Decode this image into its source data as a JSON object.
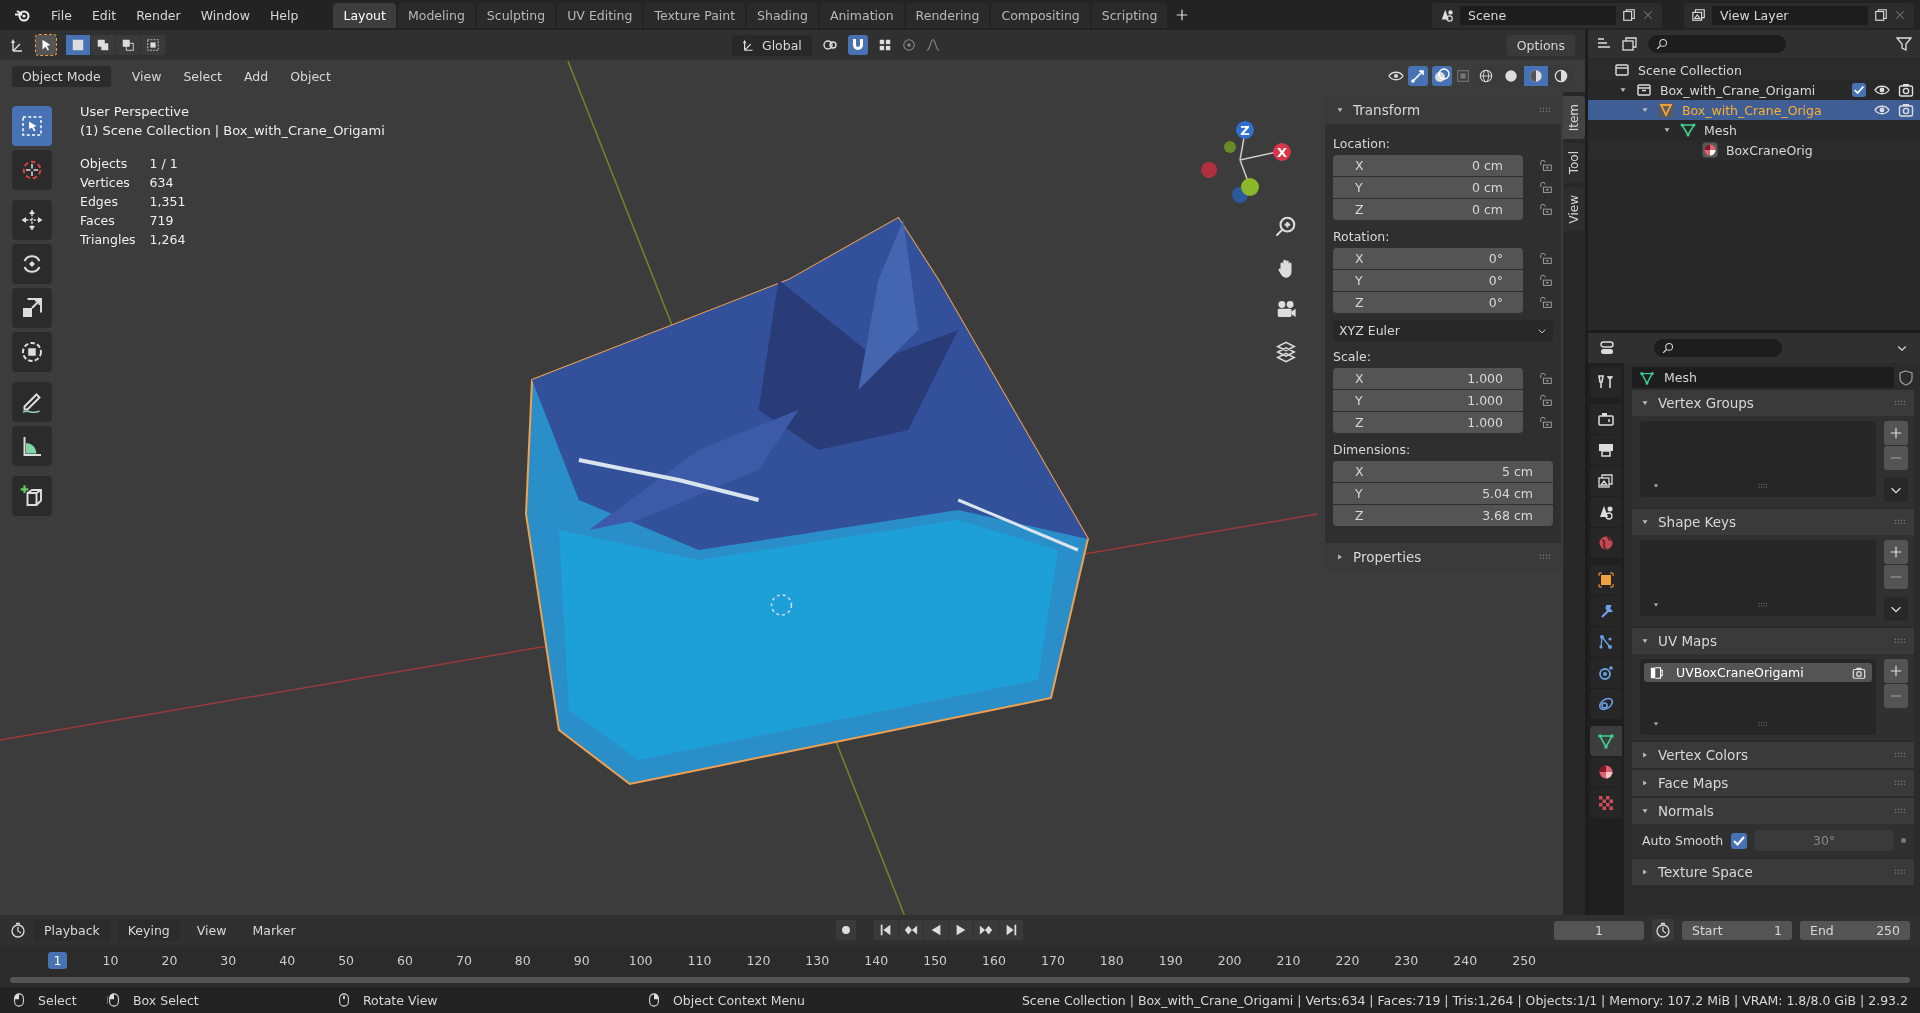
{
  "top_bar": {
    "menus": [
      "File",
      "Edit",
      "Render",
      "Window",
      "Help"
    ],
    "workspaces": [
      {
        "label": "Layout",
        "selected": true
      },
      {
        "label": "Modeling",
        "selected": false
      },
      {
        "label": "Sculpting",
        "selected": false
      },
      {
        "label": "UV Editing",
        "selected": false
      },
      {
        "label": "Texture Paint",
        "selected": false
      },
      {
        "label": "Shading",
        "selected": false
      },
      {
        "label": "Animation",
        "selected": false
      },
      {
        "label": "Rendering",
        "selected": false
      },
      {
        "label": "Compositing",
        "selected": false
      },
      {
        "label": "Scripting",
        "selected": false
      }
    ],
    "scene": "Scene",
    "view_layer": "View Layer"
  },
  "tool_settings": {
    "orientation": "Global",
    "options": "Options"
  },
  "viewport_header": {
    "mode": "Object Mode",
    "menus": [
      "View",
      "Select",
      "Add",
      "Object"
    ]
  },
  "toolbar": [
    {
      "kind": "select",
      "selected": true
    },
    {
      "kind": "cursor",
      "selected": false
    },
    {
      "kind": "move",
      "selected": false
    },
    {
      "kind": "rotate",
      "selected": false
    },
    {
      "kind": "scale",
      "selected": false
    },
    {
      "kind": "transform",
      "selected": false
    },
    {
      "kind": "annotate",
      "selected": false
    },
    {
      "kind": "measure",
      "selected": false
    },
    {
      "kind": "add_cube",
      "selected": false
    }
  ],
  "overlay": {
    "perspective": "User Perspective",
    "collection": "(1) Scene Collection | Box_with_Crane_Origami",
    "stats": [
      {
        "label": "Objects",
        "value": "1 / 1"
      },
      {
        "label": "Vertices",
        "value": "634"
      },
      {
        "label": "Edges",
        "value": "1,351"
      },
      {
        "label": "Faces",
        "value": "719"
      },
      {
        "label": "Triangles",
        "value": "1,264"
      }
    ]
  },
  "gizmo": [
    {
      "label": "Z",
      "color": "#2f6fd0"
    },
    {
      "label": "X",
      "color": "#d8344a"
    }
  ],
  "sidebar": {
    "tabs": [
      {
        "label": "Item",
        "selected": true
      },
      {
        "label": "Tool",
        "selected": false
      },
      {
        "label": "View",
        "selected": false
      }
    ],
    "transform": {
      "title": "Transform",
      "expanded": true,
      "groups": [
        {
          "label": "Location:",
          "locks": true,
          "fields": [
            {
              "axis": "X",
              "value": "0 cm"
            },
            {
              "axis": "Y",
              "value": "0 cm"
            },
            {
              "axis": "Z",
              "value": "0 cm"
            }
          ]
        },
        {
          "label": "Rotation:",
          "locks": true,
          "fields": [
            {
              "axis": "X",
              "value": "0°"
            },
            {
              "axis": "Y",
              "value": "0°"
            },
            {
              "axis": "Z",
              "value": "0°"
            }
          ],
          "mode": "XYZ Euler"
        },
        {
          "label": "Scale:",
          "locks": true,
          "fields": [
            {
              "axis": "X",
              "value": "1.000"
            },
            {
              "axis": "Y",
              "value": "1.000"
            },
            {
              "axis": "Z",
              "value": "1.000"
            }
          ]
        },
        {
          "label": "Dimensions:",
          "locks": false,
          "fields": [
            {
              "axis": "X",
              "value": "5 cm"
            },
            {
              "axis": "Y",
              "value": "5.04 cm"
            },
            {
              "axis": "Z",
              "value": "3.68 cm"
            }
          ]
        }
      ]
    },
    "properties": {
      "title": "Properties",
      "expanded": false
    }
  },
  "outliner": {
    "items": [
      {
        "label": "Scene Collection",
        "kind": "scene",
        "selected": false,
        "children": [
          {
            "label": "Box_with_Crane_Origami",
            "kind": "collection",
            "selected": false,
            "expanded": true,
            "checked": true,
            "children": [
              {
                "label": "Box_with_Crane_Origa",
                "kind": "object",
                "selected": true,
                "expanded": true,
                "children": [
                  {
                    "label": "Mesh",
                    "kind": "mesh",
                    "selected": false,
                    "expanded": true,
                    "children": [
                      {
                        "label": "BoxCraneOrig",
                        "kind": "material",
                        "selected": false
                      }
                    ]
                  }
                ]
              }
            ]
          }
        ]
      }
    ]
  },
  "properties_editor": {
    "tabs": [
      {
        "kind": "tool",
        "selected": false
      },
      {
        "kind": "render",
        "selected": false
      },
      {
        "kind": "output",
        "selected": false
      },
      {
        "kind": "view_layer",
        "selected": false
      },
      {
        "kind": "scene",
        "selected": false
      },
      {
        "kind": "world",
        "selected": false
      },
      {
        "kind": "object",
        "selected": false
      },
      {
        "kind": "modifiers",
        "selected": false
      },
      {
        "kind": "particles",
        "selected": false
      },
      {
        "kind": "physics",
        "selected": false
      },
      {
        "kind": "constraints",
        "selected": false
      },
      {
        "kind": "data",
        "selected": true
      },
      {
        "kind": "material",
        "selected": false
      },
      {
        "kind": "texture",
        "selected": false
      }
    ],
    "datablock": "Mesh",
    "panels": [
      {
        "title": "Vertex Groups",
        "expanded": true,
        "kind": "list",
        "menu": true
      },
      {
        "title": "Shape Keys",
        "expanded": true,
        "kind": "list",
        "menu": true
      },
      {
        "title": "UV Maps",
        "expanded": true,
        "kind": "list",
        "menu": false,
        "items": [
          {
            "label": "UVBoxCraneOrigami",
            "selected": true
          }
        ]
      },
      {
        "title": "Vertex Colors",
        "expanded": false
      },
      {
        "title": "Face Maps",
        "expanded": false
      },
      {
        "title": "Normals",
        "expanded": true,
        "kind": "normals",
        "auto_smooth": {
          "label": "Auto Smooth",
          "checked": true,
          "angle": "30°"
        }
      },
      {
        "title": "Texture Space",
        "expanded": false
      }
    ]
  },
  "timeline": {
    "menus": [
      "Playback",
      "Keying",
      "View",
      "Marker"
    ],
    "current_frame": "1",
    "start_label": "Start",
    "start": "1",
    "end_label": "End",
    "end": "250",
    "ruler": [
      {
        "label": "1",
        "selected": true
      },
      {
        "label": "10",
        "selected": false
      },
      {
        "label": "20",
        "selected": false
      },
      {
        "label": "30",
        "selected": false
      },
      {
        "label": "40",
        "selected": false
      },
      {
        "label": "50",
        "selected": false
      },
      {
        "label": "60",
        "selected": false
      },
      {
        "label": "70",
        "selected": false
      },
      {
        "label": "80",
        "selected": false
      },
      {
        "label": "90",
        "selected": false
      },
      {
        "label": "100",
        "selected": false
      },
      {
        "label": "110",
        "selected": false
      },
      {
        "label": "120",
        "selected": false
      },
      {
        "label": "130",
        "selected": false
      },
      {
        "label": "140",
        "selected": false
      },
      {
        "label": "150",
        "selected": false
      },
      {
        "label": "160",
        "selected": false
      },
      {
        "label": "170",
        "selected": false
      },
      {
        "label": "180",
        "selected": false
      },
      {
        "label": "190",
        "selected": false
      },
      {
        "label": "200",
        "selected": false
      },
      {
        "label": "210",
        "selected": false
      },
      {
        "label": "220",
        "selected": false
      },
      {
        "label": "230",
        "selected": false
      },
      {
        "label": "240",
        "selected": false
      },
      {
        "label": "250",
        "selected": false
      }
    ]
  },
  "status_bar": {
    "items": [
      {
        "label": "Select",
        "kind": "mouse_left"
      },
      {
        "label": "Box Select",
        "kind": "mouse_drag"
      },
      {
        "label": "Rotate View",
        "kind": "mouse_middle"
      },
      {
        "label": "Object Context Menu",
        "kind": "mouse_right"
      }
    ],
    "stats": "Scene Collection | Box_with_Crane_Origami | Verts:634 | Faces:719 | Tris:1,264 | Objects:1/1 | Memory: 107.2 MiB | VRAM: 1.8/8.0 GiB | 2.93.2"
  }
}
